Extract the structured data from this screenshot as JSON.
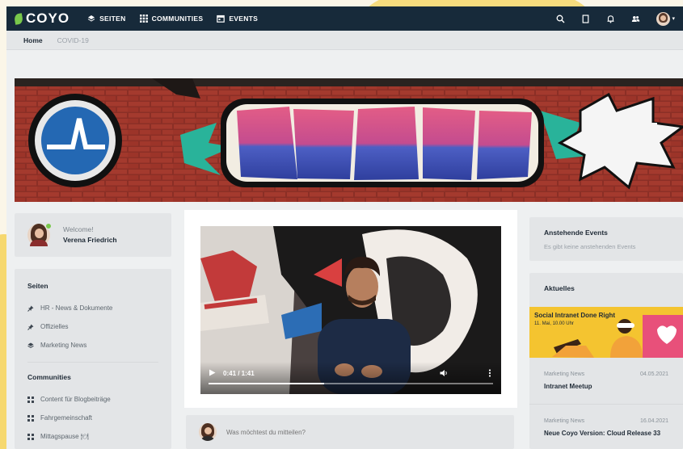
{
  "app": {
    "logo_text": "COYO"
  },
  "nav": {
    "items": [
      {
        "label": "SEITEN",
        "icon": "layers-icon"
      },
      {
        "label": "COMMUNITIES",
        "icon": "grid-icon"
      },
      {
        "label": "EVENTS",
        "icon": "calendar-icon"
      }
    ],
    "right_icons": [
      "search-icon",
      "bookmark-icon",
      "bell-icon",
      "people-icon"
    ]
  },
  "breadcrumb": {
    "home": "Home",
    "current": "COVID-19"
  },
  "welcome": {
    "greeting": "Welcome!",
    "name": "Verena Friedrich"
  },
  "sidebar": {
    "pages_title": "Seiten",
    "pages": [
      {
        "label": "HR - News & Dokumente",
        "icon": "pin-icon"
      },
      {
        "label": "Offizielles",
        "icon": "pin-icon"
      },
      {
        "label": "Marketing News",
        "icon": "layers-icon"
      }
    ],
    "communities_title": "Communities",
    "communities": [
      {
        "label": "Content für Blogbeiträge",
        "icon": "grid-icon"
      },
      {
        "label": "Fahrgemeinschaft",
        "icon": "grid-icon"
      },
      {
        "label": "Mittagspause 🍽",
        "icon": "grid-icon"
      }
    ]
  },
  "video": {
    "time": "0:41 / 1:41",
    "progress": 0.406
  },
  "post": {
    "placeholder": "Was möchtest du mitteilen?"
  },
  "events": {
    "title": "Anstehende Events",
    "empty": "Es gibt keine anstehenden Events"
  },
  "news": {
    "title": "Aktuelles",
    "featured": {
      "title": "Social Intranet Done Right",
      "date": "11. Mai, 10.00 Uhr"
    },
    "items": [
      {
        "source": "Marketing News",
        "date": "04.05.2021",
        "title": "Intranet Meetup"
      },
      {
        "source": "Marketing News",
        "date": "16.04.2021",
        "title": "Neue Coyo Version: Cloud Release 33"
      }
    ]
  },
  "colors": {
    "navbar": "#172a3a",
    "accent_green": "#79c84b",
    "page_bg": "#eef0f1",
    "yellow": "#f4c430"
  }
}
